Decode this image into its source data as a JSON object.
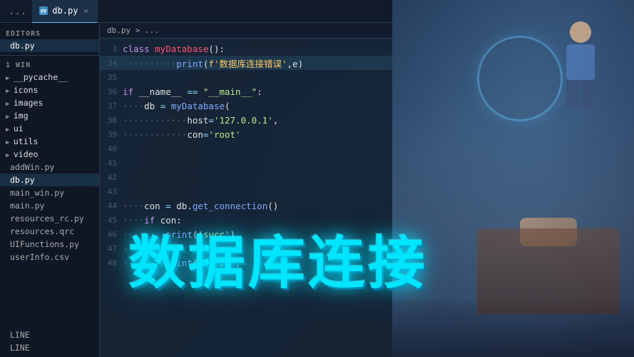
{
  "tabs": {
    "ellipsis": "...",
    "active_tab": {
      "icon": "🐍",
      "label": "db.py",
      "close": "×"
    }
  },
  "breadcrumb": {
    "path": "db.py > ..."
  },
  "sidebar": {
    "editors_label": "EDITORS",
    "active_file": "db.py",
    "win_label": "1 WIN",
    "items_under_win": [
      "__pycache__",
      "icons",
      "images",
      "img",
      "ui",
      "utils",
      "video"
    ],
    "files": [
      "addWin.py",
      "db.py",
      "main_win.py",
      "main.py",
      "resources_rc.py",
      "resources.qrc",
      "UIFunctions.py",
      "userInfo.csv"
    ],
    "bottom_items": [
      "LINE",
      "LINE"
    ]
  },
  "code": {
    "lines": [
      {
        "num": "3",
        "tokens": [
          {
            "t": "kw",
            "v": "class "
          },
          {
            "t": "cn",
            "v": "myDatabase"
          },
          {
            "t": "pl",
            "v": "():"
          }
        ]
      },
      {
        "num": "34",
        "tokens": [
          {
            "t": "dots",
            "v": "··········"
          },
          {
            "t": "fn",
            "v": "print"
          },
          {
            "t": "pl",
            "v": "("
          },
          {
            "t": "ch",
            "v": "f'数据库连接错误'"
          },
          {
            "t": "pl",
            "v": ",e)"
          }
        ]
      },
      {
        "num": "35",
        "tokens": []
      },
      {
        "num": "36",
        "tokens": [
          {
            "t": "kw",
            "v": "if "
          },
          {
            "t": "pl",
            "v": "__name__ "
          },
          {
            "t": "op",
            "v": "=="
          },
          {
            "t": "str",
            "v": " \"__main__\""
          },
          {
            "t": "pl",
            "v": ":"
          }
        ]
      },
      {
        "num": "37",
        "tokens": [
          {
            "t": "dots",
            "v": "····"
          },
          {
            "t": "pl",
            "v": "db "
          },
          {
            "t": "op",
            "v": "="
          },
          {
            "t": "pl",
            "v": " "
          },
          {
            "t": "fn",
            "v": "myDatabase"
          },
          {
            "t": "pl",
            "v": "("
          }
        ]
      },
      {
        "num": "38",
        "tokens": [
          {
            "t": "dots",
            "v": "············"
          },
          {
            "t": "pl",
            "v": "host"
          },
          {
            "t": "op",
            "v": "="
          },
          {
            "t": "str",
            "v": "'127.0.0.1'"
          },
          {
            "t": "pl",
            "v": ","
          }
        ]
      },
      {
        "num": "39",
        "tokens": [
          {
            "t": "dots",
            "v": "············"
          },
          {
            "t": "pl",
            "v": "con"
          },
          {
            "t": "op",
            "v": "="
          },
          {
            "t": "str",
            "v": "'root'"
          }
        ]
      },
      {
        "num": "40",
        "tokens": []
      },
      {
        "num": "41",
        "tokens": []
      },
      {
        "num": "42",
        "tokens": []
      },
      {
        "num": "43",
        "tokens": []
      },
      {
        "num": "44",
        "tokens": [
          {
            "t": "dots",
            "v": "····"
          },
          {
            "t": "pl",
            "v": "con "
          },
          {
            "t": "op",
            "v": "="
          },
          {
            "t": "pl",
            "v": " db."
          },
          {
            "t": "fn",
            "v": "get_connection"
          },
          {
            "t": "pl",
            "v": "()"
          }
        ]
      },
      {
        "num": "45",
        "tokens": [
          {
            "t": "dots",
            "v": "····"
          },
          {
            "t": "kw",
            "v": "if "
          },
          {
            "t": "pl",
            "v": "con:"
          }
        ]
      },
      {
        "num": "46",
        "tokens": [
          {
            "t": "dots",
            "v": "········"
          },
          {
            "t": "fn",
            "v": "print"
          },
          {
            "t": "pl",
            "v": "("
          },
          {
            "t": "str",
            "v": "'succ'"
          },
          {
            "t": "pl",
            "v": ")"
          }
        ]
      },
      {
        "num": "47",
        "tokens": [
          {
            "t": "dots",
            "v": "····"
          },
          {
            "t": "kw",
            "v": "else"
          },
          {
            "t": "pl",
            "v": ":"
          }
        ]
      },
      {
        "num": "48",
        "tokens": [
          {
            "t": "dots",
            "v": "········"
          },
          {
            "t": "fn",
            "v": "print"
          },
          {
            "t": "pl",
            "v": "("
          },
          {
            "t": "str",
            "v": "'error'"
          },
          {
            "t": "pl",
            "v": ")"
          }
        ]
      }
    ]
  },
  "overlay": {
    "title": "数据库连接"
  },
  "status": {
    "left1": "LINE",
    "left2": "LINE"
  },
  "colors": {
    "accent": "#00e5ff",
    "bg_dark": "#0f1928",
    "sidebar_bg": "#0f1623",
    "editor_bg": "#16243a"
  }
}
